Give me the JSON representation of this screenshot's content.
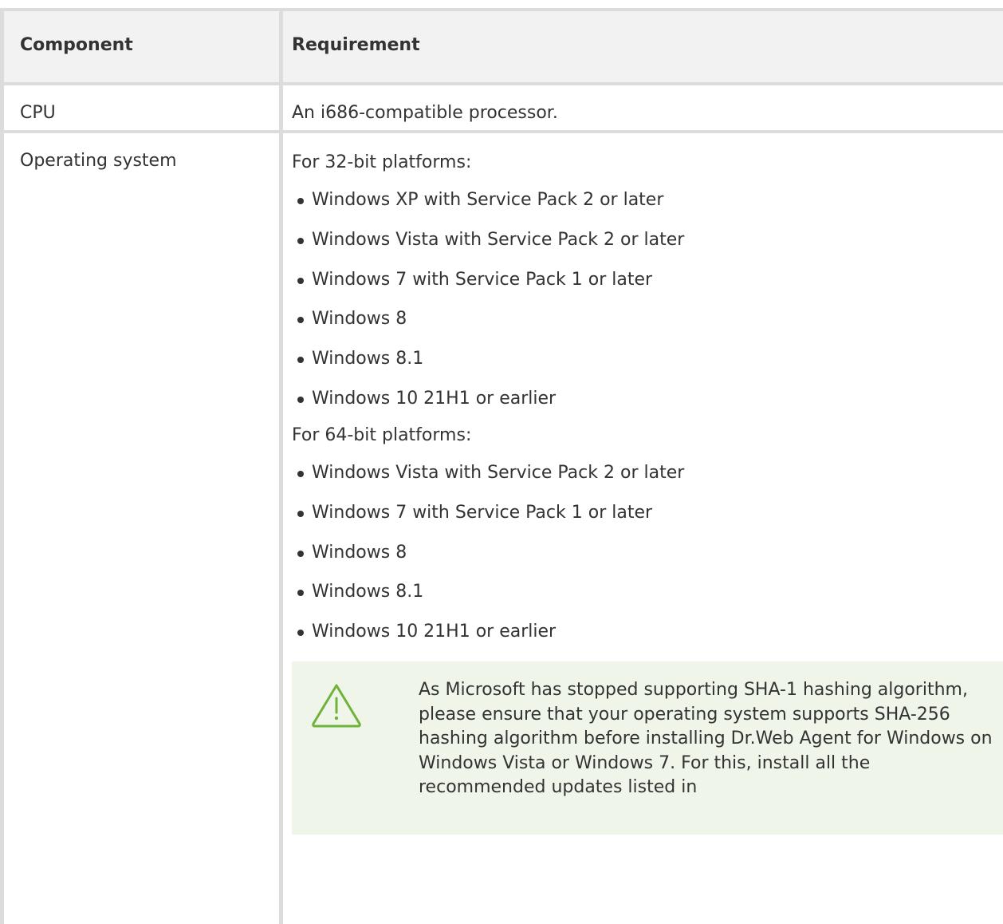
{
  "table": {
    "header": {
      "component": "Component",
      "requirement": "Requirement"
    },
    "rows": {
      "cpu": {
        "component": "CPU",
        "requirement": "An i686-compatible processor."
      },
      "os": {
        "component": "Operating system",
        "platform32": {
          "heading": "For 32-bit platforms:",
          "items": [
            "Windows XP with Service Pack 2 or later",
            "Windows Vista with Service Pack 2 or later",
            "Windows 7 with Service Pack 1 or later",
            "Windows 8",
            "Windows 8.1",
            "Windows 10 21H1 or earlier"
          ]
        },
        "platform64": {
          "heading": "For 64-bit platforms:",
          "items": [
            "Windows Vista with Service Pack 2 or later",
            "Windows 7 with Service Pack 1 or later",
            "Windows 8",
            "Windows 8.1",
            "Windows 10 21H1 or earlier"
          ]
        },
        "note": {
          "icon": "warning-triangle-icon",
          "text": "As Microsoft has stopped supporting SHA-1 hashing algorithm, please ensure that your operating system supports SHA-256 hashing algorithm before installing Dr.Web Agent for Windows on Windows Vista or Windows 7. For this, install all the recommended updates listed in"
        }
      }
    }
  },
  "colors": {
    "border": "#dcdcdc",
    "header_bg": "#f2f2f2",
    "note_bg": "#f0f5ea",
    "warning_icon": "#6fb33a",
    "text": "#333333"
  }
}
